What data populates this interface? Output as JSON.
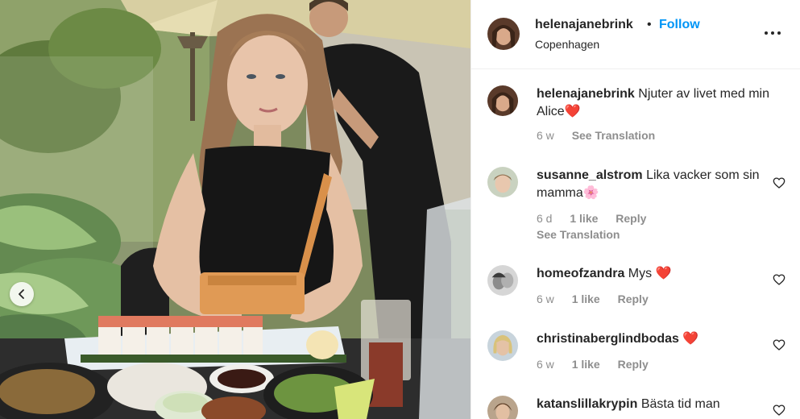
{
  "post": {
    "username": "helenajanebrink",
    "separator": "•",
    "follow_label": "Follow",
    "location": "Copenhagen",
    "more_icon": "more-options-icon"
  },
  "caption": {
    "username": "helenajanebrink",
    "text": "Njuter av livet med min Alice",
    "emoji": "❤️",
    "age": "6 w",
    "translation": "See Translation"
  },
  "comments": [
    {
      "username": "susanne_alstrom",
      "text": "Lika vacker som sin mamma",
      "emoji": "🌸",
      "age": "6 d",
      "likes": "1 like",
      "reply": "Reply",
      "translation": "See Translation"
    },
    {
      "username": "homeofzandra",
      "text": "Mys",
      "emoji": "❤️",
      "age": "6 w",
      "likes": "1 like",
      "reply": "Reply"
    },
    {
      "username": "christinaberglindbodas",
      "text": "",
      "emoji": "❤️",
      "age": "6 w",
      "likes": "1 like",
      "reply": "Reply"
    },
    {
      "username": "katanslillakrypin",
      "text": "Bästa tid man"
    }
  ],
  "colors": {
    "link_blue": "#0095f6",
    "text": "#262626",
    "meta_gray": "#8e8e8e",
    "divider": "#efefef"
  }
}
